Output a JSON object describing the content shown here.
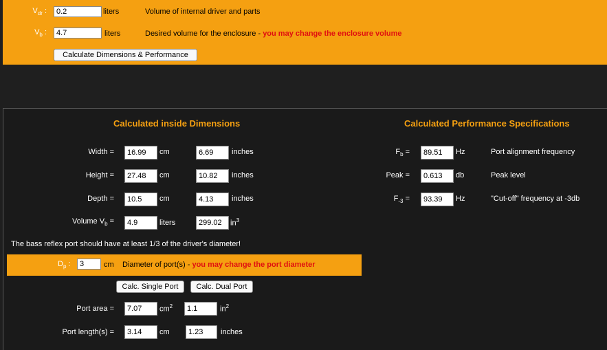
{
  "top": {
    "vdr": {
      "symbol": "V",
      "sub": "dr",
      "colon": ":",
      "value": "0.2",
      "unit": "liters",
      "desc": "Volume of internal driver and parts"
    },
    "vb": {
      "symbol": "V",
      "sub": "b",
      "colon": ":",
      "value": "4.7",
      "unit": "liters",
      "desc": "Desired volume for the enclosure - ",
      "note": "you may change the enclosure volume"
    },
    "calc_button": "Calculate Dimensions & Performance"
  },
  "dimensions": {
    "heading": "Calculated inside Dimensions",
    "rows": [
      {
        "label": "Width =",
        "cm": "16.99",
        "cm_unit": "cm",
        "in": "6.69",
        "in_unit": "inches"
      },
      {
        "label": "Height =",
        "cm": "27.48",
        "cm_unit": "cm",
        "in": "10.82",
        "in_unit": "inches"
      },
      {
        "label": "Depth =",
        "cm": "10.5",
        "cm_unit": "cm",
        "in": "4.13",
        "in_unit": "inches"
      }
    ],
    "volume": {
      "label_pre": "Volume V",
      "label_sub": "b",
      "label_post": " =",
      "liters": "4.9",
      "liters_unit": "liters",
      "in3": "299.02",
      "in3_unit": "in",
      "in3_sup": "3"
    }
  },
  "performance": {
    "heading": "Calculated Performance Specifications",
    "rows": [
      {
        "sym": "F",
        "sub": "b",
        "eq": " =",
        "value": "89.51",
        "unit": "Hz",
        "desc": "Port alignment frequency"
      },
      {
        "sym": "Peak",
        "sub": "",
        "eq": " =",
        "value": "0.613",
        "unit": "db",
        "desc": "Peak level"
      },
      {
        "sym": "F",
        "sub": "-3",
        "eq": " =",
        "value": "93.39",
        "unit": "Hz",
        "desc": "\"Cut-off\" frequency at -3db"
      }
    ]
  },
  "port": {
    "note": "The bass reflex port should have at least 1/3 of the driver's diameter!",
    "dp": {
      "symbol": "D",
      "sub": "p",
      "colon": ":",
      "value": "3",
      "unit": "cm",
      "desc": "Diameter of port(s) - ",
      "red": "you may change the port diameter"
    },
    "single_button": "Calc. Single Port",
    "dual_button": "Calc. Dual Port",
    "area": {
      "label": "Port area =",
      "cm2": "7.07",
      "cm2_unit": "cm",
      "cm2_sup": "2",
      "in2": "1.1",
      "in2_unit": "in",
      "in2_sup": "2"
    },
    "length": {
      "label": "Port length(s) =",
      "cm": "3.14",
      "cm_unit": "cm",
      "in": "1.23",
      "in_unit": "inches"
    }
  }
}
